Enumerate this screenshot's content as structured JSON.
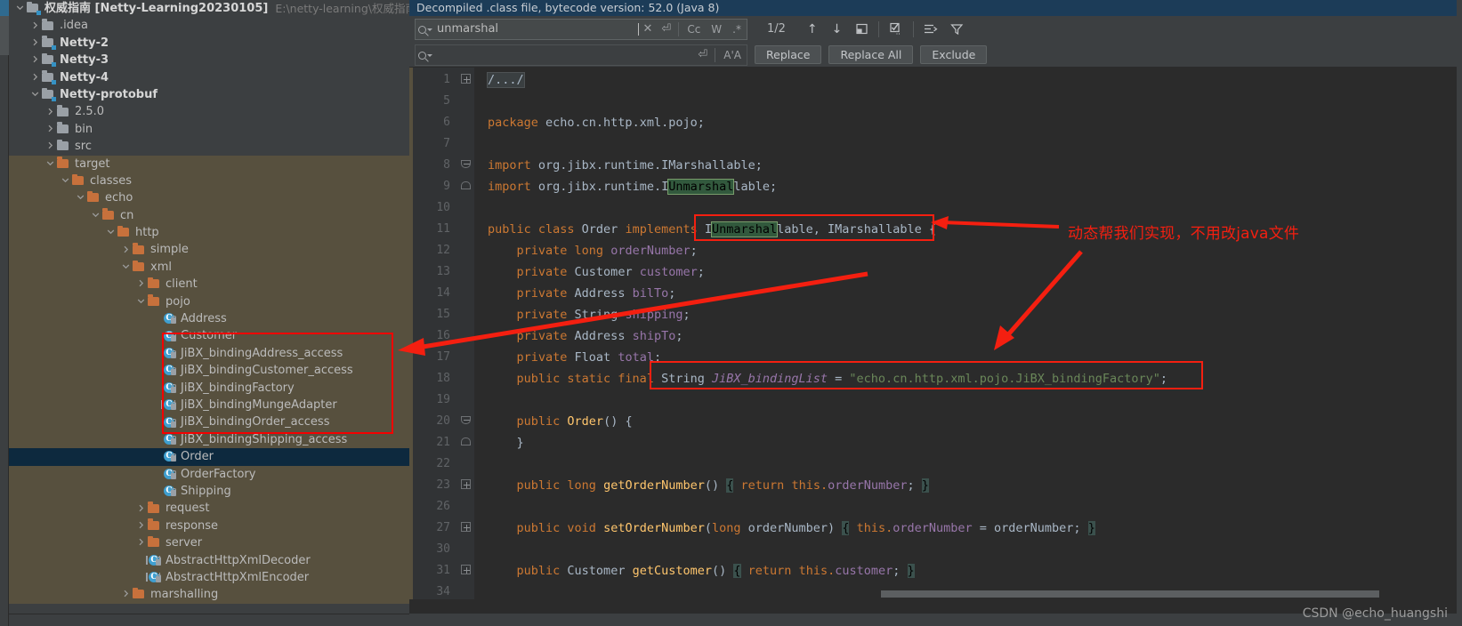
{
  "window": {
    "project_header": {
      "name_cn": "权威指南",
      "module": "[Netty-Learning20230105]",
      "path": "E:\\netty-learning\\权威指南"
    }
  },
  "project_tree": {
    "items": [
      {
        "label": "权威指南 [Netty-Learning20230105]",
        "extra": "E:\\netty-learning\\权威指南",
        "indent": 0,
        "arrow": "down",
        "icon": "module-folder-icon",
        "style": "bold",
        "state": "normal"
      },
      {
        "label": ".idea",
        "indent": 1,
        "arrow": "right",
        "icon": "folder-grey-icon",
        "style": "normal",
        "state": "normal"
      },
      {
        "label": "Netty-2",
        "indent": 1,
        "arrow": "right",
        "icon": "module-folder-icon",
        "style": "bold",
        "state": "normal"
      },
      {
        "label": "Netty-3",
        "indent": 1,
        "arrow": "right",
        "icon": "module-folder-icon",
        "style": "bold",
        "state": "normal"
      },
      {
        "label": "Netty-4",
        "indent": 1,
        "arrow": "right",
        "icon": "module-folder-icon",
        "style": "bold",
        "state": "normal"
      },
      {
        "label": "Netty-protobuf",
        "indent": 1,
        "arrow": "down",
        "icon": "module-folder-icon",
        "style": "bold",
        "state": "normal"
      },
      {
        "label": "2.5.0",
        "indent": 2,
        "arrow": "right",
        "icon": "folder-grey-icon",
        "style": "normal",
        "state": "normal"
      },
      {
        "label": "bin",
        "indent": 2,
        "arrow": "right",
        "icon": "folder-grey-icon",
        "style": "normal",
        "state": "normal"
      },
      {
        "label": "src",
        "indent": 2,
        "arrow": "right",
        "icon": "folder-grey-icon",
        "style": "normal",
        "state": "normal"
      },
      {
        "label": "target",
        "indent": 2,
        "arrow": "down",
        "icon": "folder-orange-icon",
        "style": "normal",
        "state": "tinted"
      },
      {
        "label": "classes",
        "indent": 3,
        "arrow": "down",
        "icon": "folder-orange-icon",
        "style": "normal",
        "state": "tinted"
      },
      {
        "label": "echo",
        "indent": 4,
        "arrow": "down",
        "icon": "folder-orange-icon",
        "style": "normal",
        "state": "tinted"
      },
      {
        "label": "cn",
        "indent": 5,
        "arrow": "down",
        "icon": "folder-orange-icon",
        "style": "normal",
        "state": "tinted"
      },
      {
        "label": "http",
        "indent": 6,
        "arrow": "down",
        "icon": "folder-orange-icon",
        "style": "normal",
        "state": "tinted"
      },
      {
        "label": "simple",
        "indent": 7,
        "arrow": "right",
        "icon": "folder-orange-icon",
        "style": "normal",
        "state": "tinted"
      },
      {
        "label": "xml",
        "indent": 7,
        "arrow": "down",
        "icon": "folder-orange-icon",
        "style": "normal",
        "state": "tinted"
      },
      {
        "label": "client",
        "indent": 8,
        "arrow": "right",
        "icon": "folder-orange-icon",
        "style": "normal",
        "state": "tinted"
      },
      {
        "label": "pojo",
        "indent": 8,
        "arrow": "down",
        "icon": "folder-orange-icon",
        "style": "normal",
        "state": "tinted"
      },
      {
        "label": "Address",
        "indent": 9,
        "arrow": "none",
        "icon": "class-icon",
        "style": "normal",
        "state": "tinted"
      },
      {
        "label": "Customer",
        "indent": 9,
        "arrow": "none",
        "icon": "class-icon",
        "style": "normal",
        "state": "tinted"
      },
      {
        "label": "JiBX_bindingAddress_access",
        "indent": 9,
        "arrow": "none",
        "icon": "class-icon",
        "style": "normal",
        "state": "tinted"
      },
      {
        "label": "JiBX_bindingCustomer_access",
        "indent": 9,
        "arrow": "none",
        "icon": "class-icon",
        "style": "normal",
        "state": "tinted"
      },
      {
        "label": "JiBX_bindingFactory",
        "indent": 9,
        "arrow": "none",
        "icon": "class-icon",
        "style": "normal",
        "state": "tinted"
      },
      {
        "label": "JiBX_bindingMungeAdapter",
        "indent": 9,
        "arrow": "none",
        "icon": "abstract-class-icon",
        "style": "normal",
        "state": "tinted"
      },
      {
        "label": "JiBX_bindingOrder_access",
        "indent": 9,
        "arrow": "none",
        "icon": "class-icon",
        "style": "normal",
        "state": "tinted"
      },
      {
        "label": "JiBX_bindingShipping_access",
        "indent": 9,
        "arrow": "none",
        "icon": "class-icon",
        "style": "normal",
        "state": "tinted"
      },
      {
        "label": "Order",
        "indent": 9,
        "arrow": "none",
        "icon": "class-icon",
        "style": "normal",
        "state": "selected"
      },
      {
        "label": "OrderFactory",
        "indent": 9,
        "arrow": "none",
        "icon": "class-icon",
        "style": "normal",
        "state": "tinted"
      },
      {
        "label": "Shipping",
        "indent": 9,
        "arrow": "none",
        "icon": "class-icon",
        "style": "normal",
        "state": "tinted"
      },
      {
        "label": "request",
        "indent": 8,
        "arrow": "right",
        "icon": "folder-orange-icon",
        "style": "normal",
        "state": "tinted"
      },
      {
        "label": "response",
        "indent": 8,
        "arrow": "right",
        "icon": "folder-orange-icon",
        "style": "normal",
        "state": "tinted"
      },
      {
        "label": "server",
        "indent": 8,
        "arrow": "right",
        "icon": "folder-orange-icon",
        "style": "normal",
        "state": "tinted"
      },
      {
        "label": "AbstractHttpXmlDecoder",
        "indent": 8,
        "arrow": "none",
        "icon": "abstract-class-icon",
        "style": "normal",
        "state": "tinted"
      },
      {
        "label": "AbstractHttpXmlEncoder",
        "indent": 8,
        "arrow": "none",
        "icon": "abstract-class-icon",
        "style": "normal",
        "state": "tinted"
      },
      {
        "label": "marshalling",
        "indent": 7,
        "arrow": "right",
        "icon": "folder-orange-icon",
        "style": "normal",
        "state": "tinted"
      }
    ]
  },
  "editor": {
    "decompiled_banner": "Decompiled .class file, bytecode version: 52.0 (Java 8)",
    "find": {
      "search_value": "unmarshal",
      "replace_placeholder": "",
      "match_count": "1/2",
      "case_label": "Cc",
      "words_label": "W",
      "regex_label": ".*",
      "preserve_case_label": "A'A",
      "buttons": {
        "replace": "Replace",
        "replace_all": "Replace All",
        "exclude": "Exclude"
      },
      "icons": {
        "search": "search-icon",
        "close": "close-icon",
        "history": "new-line-icon",
        "prev": "prev-match-icon",
        "next": "next-match-icon",
        "open_in_window": "open-in-find-window-icon",
        "select_all": "select-all-occurrences-icon",
        "scope": "filter-scope-icon",
        "filter": "filter-icon"
      }
    },
    "code_lines": [
      {
        "num": "1",
        "fold": "plus",
        "tokens": [
          {
            "t": "/.../",
            "c": "foldph"
          }
        ]
      },
      {
        "num": "5",
        "fold": "none",
        "tokens": []
      },
      {
        "num": "6",
        "fold": "none",
        "tokens": [
          {
            "t": "package ",
            "c": "kw"
          },
          {
            "t": "echo.cn.http.xml.pojo;",
            "c": "plain"
          }
        ]
      },
      {
        "num": "7",
        "fold": "none",
        "tokens": []
      },
      {
        "num": "8",
        "fold": "open",
        "tokens": [
          {
            "t": "import ",
            "c": "kw"
          },
          {
            "t": "org.jibx.runtime.IMarshallable;",
            "c": "plain"
          }
        ]
      },
      {
        "num": "9",
        "fold": "end",
        "tokens": [
          {
            "t": "import ",
            "c": "kw"
          },
          {
            "t": "org.jibx.runtime.I",
            "c": "plain"
          },
          {
            "t": "Unmarshal",
            "c": "hl"
          },
          {
            "t": "lable;",
            "c": "plain"
          }
        ]
      },
      {
        "num": "10",
        "fold": "none",
        "tokens": []
      },
      {
        "num": "11",
        "fold": "none",
        "tokens": [
          {
            "t": "public class ",
            "c": "kw"
          },
          {
            "t": "Order ",
            "c": "plain"
          },
          {
            "t": "implements ",
            "c": "kw"
          },
          {
            "t": "I",
            "c": "plain"
          },
          {
            "t": "Unmarshal",
            "c": "hl"
          },
          {
            "t": "lable, IMarshallable",
            "c": "plain"
          },
          {
            "t": " {",
            "c": "plain"
          }
        ]
      },
      {
        "num": "12",
        "fold": "none",
        "tokens": [
          {
            "t": "    ",
            "c": "plain"
          },
          {
            "t": "private long ",
            "c": "kw"
          },
          {
            "t": "orderNumber",
            "c": "fld"
          },
          {
            "t": ";",
            "c": "plain"
          }
        ]
      },
      {
        "num": "13",
        "fold": "none",
        "tokens": [
          {
            "t": "    ",
            "c": "plain"
          },
          {
            "t": "private ",
            "c": "kw"
          },
          {
            "t": "Customer ",
            "c": "plain"
          },
          {
            "t": "customer",
            "c": "fld"
          },
          {
            "t": ";",
            "c": "plain"
          }
        ]
      },
      {
        "num": "14",
        "fold": "none",
        "tokens": [
          {
            "t": "    ",
            "c": "plain"
          },
          {
            "t": "private ",
            "c": "kw"
          },
          {
            "t": "Address ",
            "c": "plain"
          },
          {
            "t": "bilTo",
            "c": "fld"
          },
          {
            "t": ";",
            "c": "plain"
          }
        ]
      },
      {
        "num": "15",
        "fold": "none",
        "tokens": [
          {
            "t": "    ",
            "c": "plain"
          },
          {
            "t": "private ",
            "c": "kw"
          },
          {
            "t": "String ",
            "c": "plain"
          },
          {
            "t": "shipping",
            "c": "fld"
          },
          {
            "t": ";",
            "c": "plain"
          }
        ]
      },
      {
        "num": "16",
        "fold": "none",
        "tokens": [
          {
            "t": "    ",
            "c": "plain"
          },
          {
            "t": "private ",
            "c": "kw"
          },
          {
            "t": "Address ",
            "c": "plain"
          },
          {
            "t": "shipTo",
            "c": "fld"
          },
          {
            "t": ";",
            "c": "plain"
          }
        ]
      },
      {
        "num": "17",
        "fold": "none",
        "tokens": [
          {
            "t": "    ",
            "c": "plain"
          },
          {
            "t": "private ",
            "c": "kw"
          },
          {
            "t": "Float ",
            "c": "plain"
          },
          {
            "t": "total",
            "c": "fld"
          },
          {
            "t": ";",
            "c": "plain"
          }
        ]
      },
      {
        "num": "18",
        "fold": "none",
        "tokens": [
          {
            "t": "    ",
            "c": "plain"
          },
          {
            "t": "public static final ",
            "c": "kw"
          },
          {
            "t": "String ",
            "c": "plain"
          },
          {
            "t": "JiBX_bindingList",
            "c": "sfld"
          },
          {
            "t": " = ",
            "c": "plain"
          },
          {
            "t": "\"echo.cn.http.xml.pojo.JiBX_bindingFactory\"",
            "c": "str"
          },
          {
            "t": ";",
            "c": "plain"
          }
        ]
      },
      {
        "num": "19",
        "fold": "none",
        "tokens": []
      },
      {
        "num": "20",
        "fold": "open",
        "tokens": [
          {
            "t": "    ",
            "c": "plain"
          },
          {
            "t": "public ",
            "c": "kw"
          },
          {
            "t": "Order",
            "c": "mth"
          },
          {
            "t": "() {",
            "c": "plain"
          }
        ]
      },
      {
        "num": "21",
        "fold": "end",
        "tokens": [
          {
            "t": "    }",
            "c": "plain"
          }
        ]
      },
      {
        "num": "22",
        "fold": "none",
        "tokens": []
      },
      {
        "num": "23",
        "fold": "plus",
        "tokens": [
          {
            "t": "    ",
            "c": "plain"
          },
          {
            "t": "public long ",
            "c": "kw"
          },
          {
            "t": "getOrderNumber",
            "c": "mth"
          },
          {
            "t": "() ",
            "c": "plain"
          },
          {
            "t": "{",
            "c": "brcmatch"
          },
          {
            "t": " ",
            "c": "plain"
          },
          {
            "t": "return ",
            "c": "kw"
          },
          {
            "t": "this.",
            "c": "kw"
          },
          {
            "t": "orderNumber",
            "c": "fld"
          },
          {
            "t": "; ",
            "c": "plain"
          },
          {
            "t": "}",
            "c": "brcmatch"
          }
        ]
      },
      {
        "num": "26",
        "fold": "none",
        "tokens": []
      },
      {
        "num": "27",
        "fold": "plus",
        "tokens": [
          {
            "t": "    ",
            "c": "plain"
          },
          {
            "t": "public void ",
            "c": "kw"
          },
          {
            "t": "setOrderNumber",
            "c": "mth"
          },
          {
            "t": "(",
            "c": "plain"
          },
          {
            "t": "long ",
            "c": "kw"
          },
          {
            "t": "orderNumber",
            "c": "plain"
          },
          {
            "t": ") ",
            "c": "plain"
          },
          {
            "t": "{",
            "c": "brcmatch"
          },
          {
            "t": " ",
            "c": "plain"
          },
          {
            "t": "this.",
            "c": "kw"
          },
          {
            "t": "orderNumber",
            "c": "fld"
          },
          {
            "t": " = orderNumber; ",
            "c": "plain"
          },
          {
            "t": "}",
            "c": "brcmatch"
          }
        ]
      },
      {
        "num": "30",
        "fold": "none",
        "tokens": []
      },
      {
        "num": "31",
        "fold": "plus",
        "tokens": [
          {
            "t": "    ",
            "c": "plain"
          },
          {
            "t": "public ",
            "c": "kw"
          },
          {
            "t": "Customer ",
            "c": "plain"
          },
          {
            "t": "getCustomer",
            "c": "mth"
          },
          {
            "t": "() ",
            "c": "plain"
          },
          {
            "t": "{",
            "c": "brcmatch"
          },
          {
            "t": " ",
            "c": "plain"
          },
          {
            "t": "return ",
            "c": "kw"
          },
          {
            "t": "this.",
            "c": "kw"
          },
          {
            "t": "customer",
            "c": "fld"
          },
          {
            "t": "; ",
            "c": "plain"
          },
          {
            "t": "}",
            "c": "brcmatch"
          }
        ]
      },
      {
        "num": "34",
        "fold": "none",
        "tokens": []
      }
    ]
  },
  "annotations": {
    "note": "动态帮我们实现，不用改java文件",
    "color": "#f41f10"
  },
  "watermark": "CSDN @echo_huangshi"
}
